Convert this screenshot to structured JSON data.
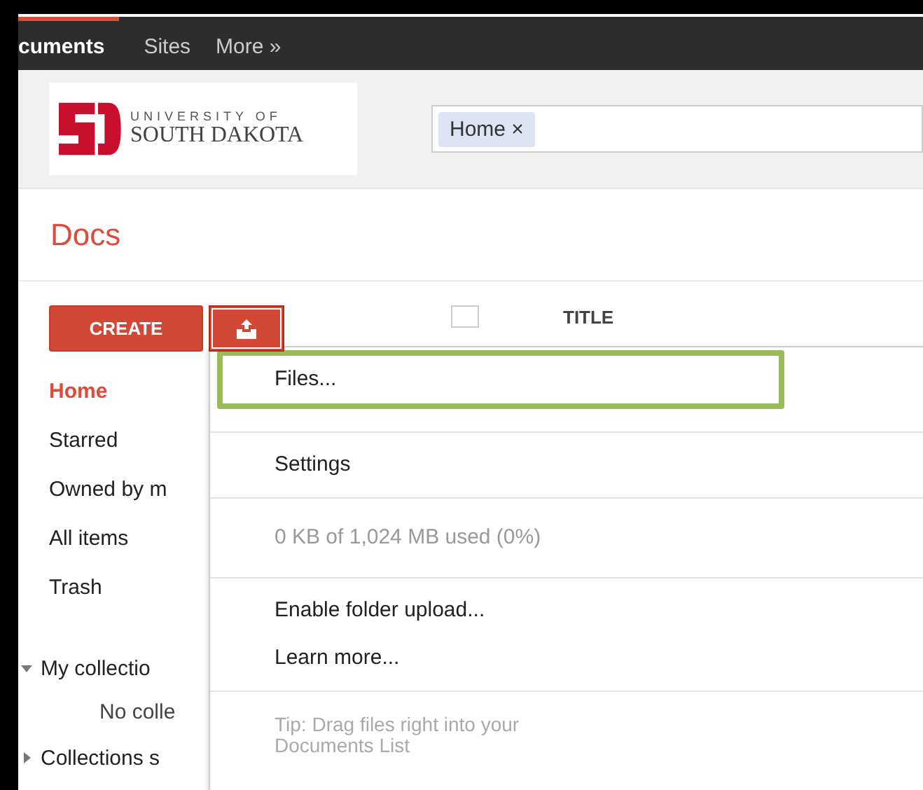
{
  "nav": {
    "items": [
      {
        "label": "cuments",
        "selected": true
      },
      {
        "label": "Sites",
        "selected": false
      },
      {
        "label": "More »",
        "selected": false
      }
    ]
  },
  "logo": {
    "line1": "UNIVERSITY OF",
    "line2": "SOUTH DAKOTA"
  },
  "search": {
    "chips": [
      {
        "label": "Home",
        "remove": "×"
      }
    ]
  },
  "app_title": "Docs",
  "create_button": "CREATE",
  "table": {
    "select_all_checked": false,
    "columns": [
      {
        "label": "TITLE"
      }
    ]
  },
  "sidebar": {
    "items": [
      {
        "label": "Home",
        "selected": true
      },
      {
        "label": "Starred",
        "selected": false
      },
      {
        "label": "Owned by m",
        "selected": false
      },
      {
        "label": "All items",
        "selected": false
      },
      {
        "label": "Trash",
        "selected": false
      }
    ]
  },
  "collections": [
    {
      "label": "My collectio",
      "expanded": true,
      "children": [
        {
          "label": "No colle"
        }
      ]
    },
    {
      "label": "Collections s",
      "expanded": false
    }
  ],
  "upload_menu": {
    "items": [
      {
        "kind": "item",
        "label": "Files...",
        "highlighted": true
      },
      {
        "kind": "divider"
      },
      {
        "kind": "item",
        "label": "Settings",
        "highlighted": false
      },
      {
        "kind": "divider"
      },
      {
        "kind": "info",
        "label": "0 KB of 1,024 MB used (0%)"
      },
      {
        "kind": "divider"
      },
      {
        "kind": "item",
        "label": "Enable folder upload...",
        "highlighted": false
      },
      {
        "kind": "item",
        "label": "Learn more...",
        "highlighted": false
      },
      {
        "kind": "divider"
      },
      {
        "kind": "tip",
        "label": "Tip: Drag files right into your Documents List"
      }
    ]
  }
}
